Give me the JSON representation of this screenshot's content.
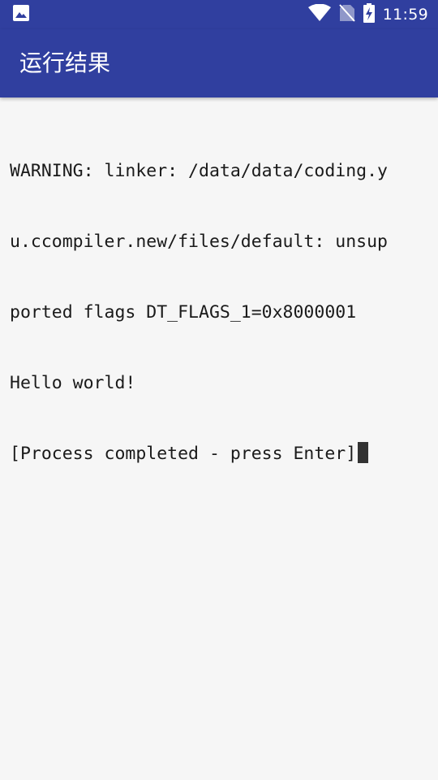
{
  "status_bar": {
    "time": "11:59",
    "icons": [
      "image-notification-icon",
      "wifi-icon",
      "no-sim-icon",
      "battery-charging-icon"
    ]
  },
  "toolbar": {
    "title": "运行结果"
  },
  "terminal": {
    "lines": [
      "WARNING: linker: /data/data/coding.y",
      "u.ccompiler.new/files/default: unsup",
      "ported flags DT_FLAGS_1=0x8000001",
      "Hello world!",
      "[Process completed - press Enter]"
    ]
  },
  "colors": {
    "primary": "#303f9f",
    "background": "#f6f6f6",
    "text": "#1a1a1a",
    "cursor": "#333333"
  }
}
